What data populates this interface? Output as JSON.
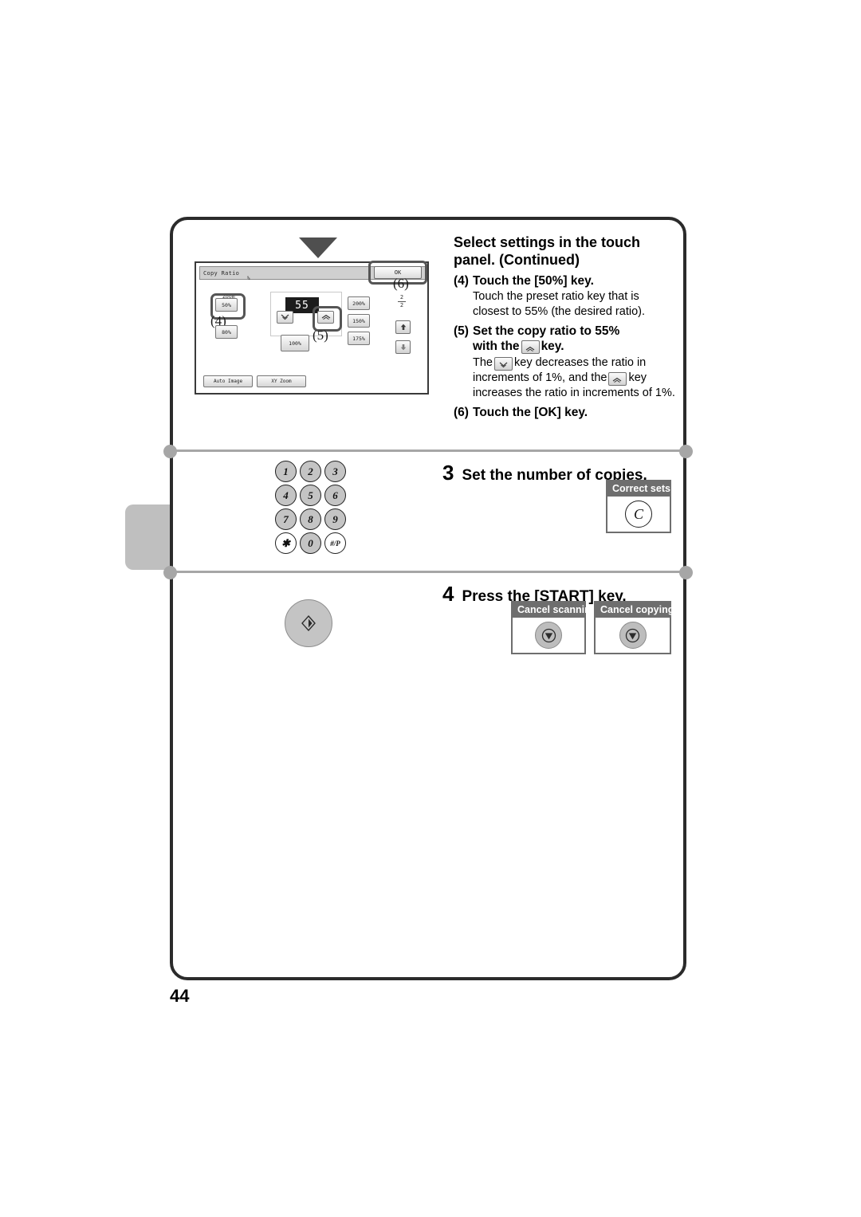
{
  "page": {
    "number": "44"
  },
  "section_continued": {
    "title": "Select settings in the touch panel. (Continued)",
    "steps": [
      {
        "num": "(4)",
        "heading": "Touch the [50%] key.",
        "body": "Touch the preset ratio key that is closest to 55% (the desired ratio)."
      },
      {
        "num": "(5)",
        "heading_part1": "Set the copy ratio to 55%",
        "heading_part2_pre": "with the",
        "heading_part2_post": "key.",
        "body_1": "The",
        "body_2": "key decreases the ratio in increments of 1%, and the",
        "body_3": "key increases the ratio in increments of 1%."
      },
      {
        "num": "(6)",
        "heading": "Touch the [OK] key."
      }
    ]
  },
  "lcd": {
    "title": "Copy Ratio",
    "ok_label": "OK",
    "ratio_value": "55",
    "percent_sign": "%",
    "zoom_label": "Zoom",
    "preset_keys": {
      "k50": "50%",
      "k80": "80%",
      "k100": "100%",
      "k200": "200%",
      "k150": "150%",
      "k175": "175%"
    },
    "bottom_keys": {
      "auto_image": "Auto Image",
      "xy_zoom": "XY Zoom"
    },
    "page_indicator": {
      "current": "2",
      "total": "2"
    },
    "callouts": {
      "c4": "(4)",
      "c5": "(5)",
      "c6": "(6)"
    }
  },
  "section_copies": {
    "number": "3",
    "title": "Set the number of copies.",
    "keypad": [
      "1",
      "2",
      "3",
      "4",
      "5",
      "6",
      "7",
      "8",
      "9",
      "✱",
      "0",
      "#/P"
    ],
    "correct_sets": {
      "label": "Correct sets",
      "key": "C"
    }
  },
  "section_start": {
    "number": "4",
    "title": "Press the [START] key.",
    "cancel_scanning": {
      "label": "Cancel scanning"
    },
    "cancel_copying": {
      "label": "Cancel copying"
    }
  },
  "colors": {
    "border": "#2b2b2b",
    "divider": "#a6a6a6",
    "card_gray": "#6e6e6e",
    "key_gray": "#c4c4c4"
  }
}
